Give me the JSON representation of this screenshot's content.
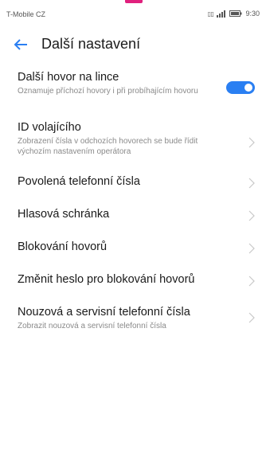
{
  "status_bar": {
    "carrier": "T-Mobile CZ",
    "time": "9:30",
    "icons": [
      "sim-icon",
      "signal-icon",
      "battery-icon"
    ]
  },
  "app_bar": {
    "back_icon": "arrow-left-icon",
    "title": "Další nastavení"
  },
  "colors": {
    "accent": "#2a7ff2",
    "top_accent": "#e0207d"
  },
  "settings": {
    "items": [
      {
        "title": "Další hovor na lince",
        "subtitle": "Oznamuje příchozí hovory i při probíhajícím hovoru",
        "control": "toggle",
        "toggle_on": true
      },
      {
        "title": "ID volajícího",
        "subtitle": "Zobrazení čísla v odchozích hovorech se bude řídit výchozím nastavením operátora",
        "control": "chevron"
      },
      {
        "title": "Povolená telefonní čísla",
        "control": "chevron"
      },
      {
        "title": "Hlasová schránka",
        "control": "chevron"
      },
      {
        "title": "Blokování hovorů",
        "control": "chevron"
      },
      {
        "title": "Změnit heslo pro blokování hovorů",
        "control": "chevron"
      },
      {
        "title": "Nouzová a servisní telefonní čísla",
        "subtitle": "Zobrazit nouzová a servisní telefonní čísla",
        "control": "chevron"
      }
    ]
  }
}
